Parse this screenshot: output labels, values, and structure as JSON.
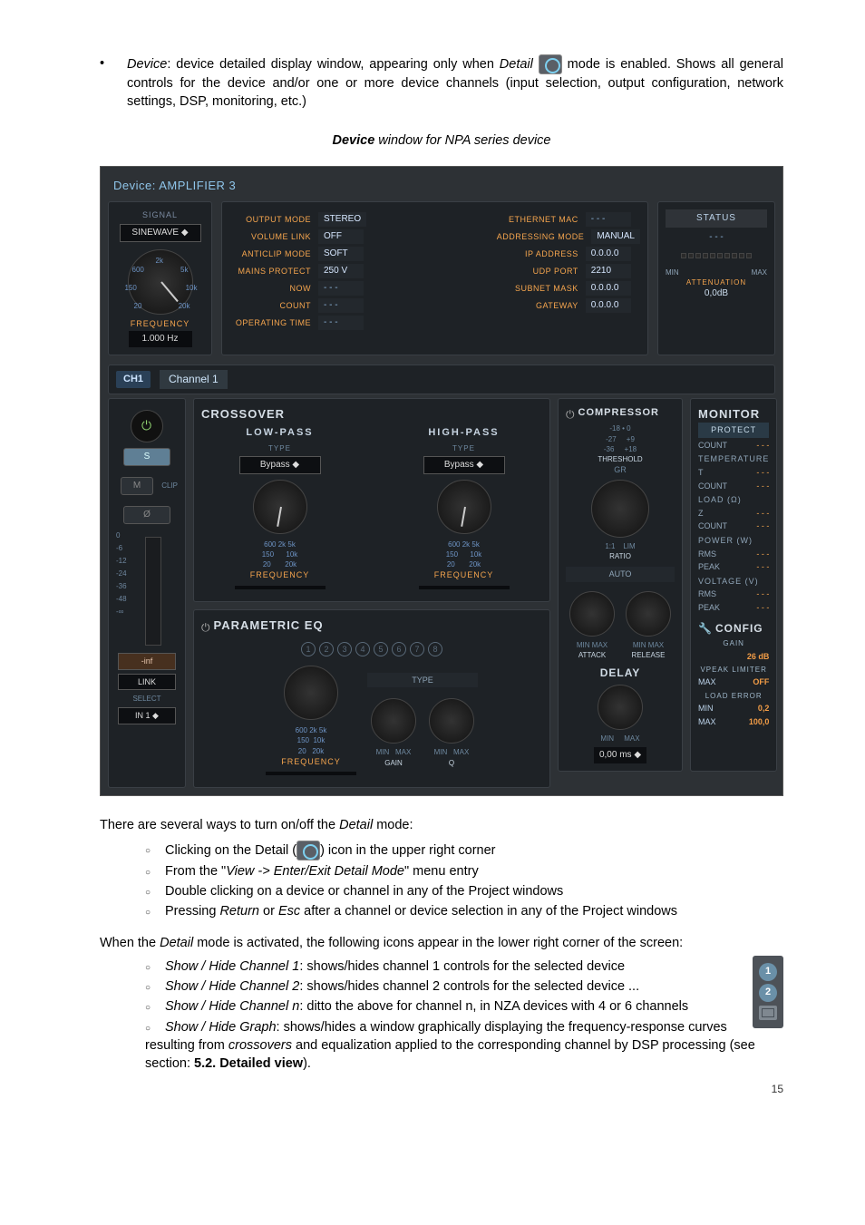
{
  "intro": {
    "bullet": "•",
    "device_label": "Device",
    "intro_1": ": device detailed display window, appearing only when ",
    "detail_word": "Detail",
    "intro_2": " mode is enabled. Shows all general controls for the device and/or one or more device channels (input selection, output configuration, network settings, DSP, monitoring, etc.)"
  },
  "caption": {
    "b": "Device",
    "rest": " window for NPA series device"
  },
  "device_window": {
    "title_prefix": "Device:",
    "title_name": "AMPLIFIER 3",
    "signal": {
      "label": "SIGNAL",
      "select": "SINEWAVE",
      "ticks": {
        "t600": "600",
        "t2k": "2k",
        "t5k": "5k",
        "t150": "150",
        "t10k": "10k",
        "t20": "20",
        "t20k": "20k"
      },
      "freq_label": "FREQUENCY",
      "freq_value": "1.000 Hz"
    },
    "info_left": {
      "output_mode_k": "OUTPUT MODE",
      "output_mode_v": "STEREO",
      "volume_link_k": "VOLUME LINK",
      "volume_link_v": "OFF",
      "anticlip_k": "ANTICLIP MODE",
      "anticlip_v": "SOFT",
      "mains_k": "MAINS PROTECT",
      "mains_v": "250 V",
      "now_k": "NOW",
      "now_v": "- - -",
      "count_k": "COUNT",
      "count_v": "- - -",
      "optime_k": "OPERATING TIME",
      "optime_v": "- - -"
    },
    "info_right": {
      "mac_k": "ETHERNET MAC",
      "mac_v": "- - -",
      "addr_k": "ADDRESSING MODE",
      "addr_v": "MANUAL",
      "ip_k": "IP ADDRESS",
      "ip_v": "0.0.0.0",
      "udp_k": "UDP PORT",
      "udp_v": "2210",
      "mask_k": "SUBNET MASK",
      "mask_v": "0.0.0.0",
      "gw_k": "GATEWAY",
      "gw_v": "0.0.0.0"
    },
    "status": {
      "title": "STATUS",
      "dash": "- - -",
      "min": "MIN",
      "max": "MAX",
      "att": "ATTENUATION",
      "att_v": "0,0dB"
    },
    "ch": {
      "tag": "CH1",
      "name": "Channel 1",
      "crossover": "CROSSOVER",
      "lowpass": "LOW-PASS",
      "highpass": "HIGH-PASS",
      "type": "TYPE",
      "bypass": "Bypass",
      "frequency": "FREQUENCY",
      "peq": "PARAMETRIC EQ",
      "nums": [
        "1",
        "2",
        "3",
        "4",
        "5",
        "6",
        "7",
        "8"
      ],
      "type_box": "TYPE",
      "gain": "GAIN",
      "q": "Q",
      "min": "MIN",
      "max": "MAX",
      "ticks": {
        "t600": "600",
        "t2k": "2k",
        "t5k": "5k",
        "t150": "150",
        "t10k": "10k",
        "t20": "20",
        "t20k": "20k"
      }
    },
    "left": {
      "s": "S",
      "m": "M",
      "clip": "CLIP",
      "ov": "Ø",
      "scale": [
        "0",
        "-6",
        "-12",
        "-24",
        "-36",
        "-48",
        "-∞"
      ],
      "inf": "-inf",
      "link": "LINK",
      "select": "SELECT",
      "in1": "IN 1"
    },
    "comp": {
      "title": "COMPRESSOR",
      "t18": "-18",
      "t0": "0",
      "t27": "-27",
      "t9": "+9",
      "t36": "-36",
      "t18p": "+18",
      "threshold": "THRESHOLD",
      "gr": "GR",
      "ratio": "RATIO",
      "r11": "1:1",
      "lim": "LIM",
      "auto": "AUTO",
      "attack": "ATTACK",
      "release": "RELEASE",
      "min": "MIN",
      "max": "MAX"
    },
    "delay": {
      "title": "DELAY",
      "min": "MIN",
      "max": "MAX",
      "val": "0,00 ms"
    },
    "monitor": {
      "title": "MONITOR",
      "protect": "PROTECT",
      "count": "COUNT",
      "dash": "- - -",
      "temperature": "TEMPERATURE",
      "t": "T",
      "load": "LOAD (Ω)",
      "z": "Z",
      "power": "POWER (W)",
      "rms": "RMS",
      "peak": "PEAK",
      "voltage": "VOLTAGE (V)"
    },
    "config": {
      "title": "CONFIG",
      "gain": "GAIN",
      "gain_v": "26 dB",
      "vpeak": "VPEAK LIMITER",
      "max": "MAX",
      "off": "OFF",
      "loaderr": "LOAD ERROR",
      "min": "MIN",
      "min_v": "0,2",
      "max_v": "100,0"
    }
  },
  "after": {
    "line1": "There are several ways to turn on/off the ",
    "detail": "Detail",
    "line1b": " mode:",
    "li1a": "Clicking on the Detail (",
    "li1b": ") icon in the upper right corner",
    "li2a": "From the \"",
    "li2i": "View -> Enter/Exit Detail Mode",
    "li2b": "\" menu entry",
    "li3": "Double clicking on a device or channel in any of the Project windows",
    "li4a": "Pressing ",
    "li4r": "Return",
    "li4b": " or ",
    "li4e": "Esc",
    "li4c": " after a channel or device selection in any of the Project windows",
    "p2a": "When the ",
    "p2b": " mode is activated, the following icons appear in the lower right corner of the screen:",
    "s1i": "Show / Hide Channel 1",
    "s1": ": shows/hides channel 1 controls for the selected device",
    "s2i": "Show / Hide Channel 2",
    "s2": ": shows/hides channel 2 controls for the selected device ...",
    "s3i": "Show / Hide Channel n",
    "s3": ": ditto the above for channel n, in NZA devices with 4 or 6 channels",
    "s4i": "Show / Hide Graph",
    "s4a": ": shows/hides a window graphically displaying the frequency-response curves resulting from ",
    "s4cr": "crossovers",
    "s4b": " and equalization applied to the corresponding channel by DSP processing (see section: ",
    "s4sec": "5.2. Detailed view",
    "s4c": ")."
  },
  "side": {
    "c1": "1",
    "c2": "2"
  },
  "pagenum": "15"
}
